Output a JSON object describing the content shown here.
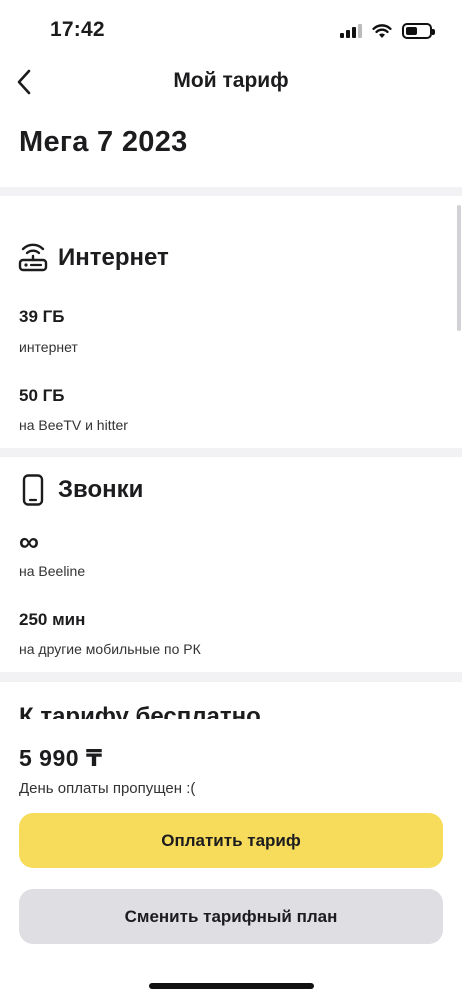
{
  "status_bar": {
    "time": "17:42"
  },
  "nav": {
    "title": "Мой тариф"
  },
  "plan": {
    "name": "Мега 7 2023"
  },
  "internet": {
    "title": "Интернет",
    "items": [
      {
        "value": "39 ГБ",
        "description": "интернет"
      },
      {
        "value": "50 ГБ",
        "description": "на BeeTV и hitter"
      }
    ]
  },
  "calls": {
    "title": "Звонки",
    "items": [
      {
        "value": "∞",
        "description": "на Beeline"
      },
      {
        "value": "250 мин",
        "description": "на другие мобильные по РК"
      }
    ]
  },
  "free_section": {
    "title": "К тарифу бесплатно"
  },
  "billing": {
    "price": "5 990 ₸",
    "status": "День оплаты пропущен :("
  },
  "actions": {
    "pay_label": "Оплатить тариф",
    "change_label": "Сменить тарифный план"
  }
}
